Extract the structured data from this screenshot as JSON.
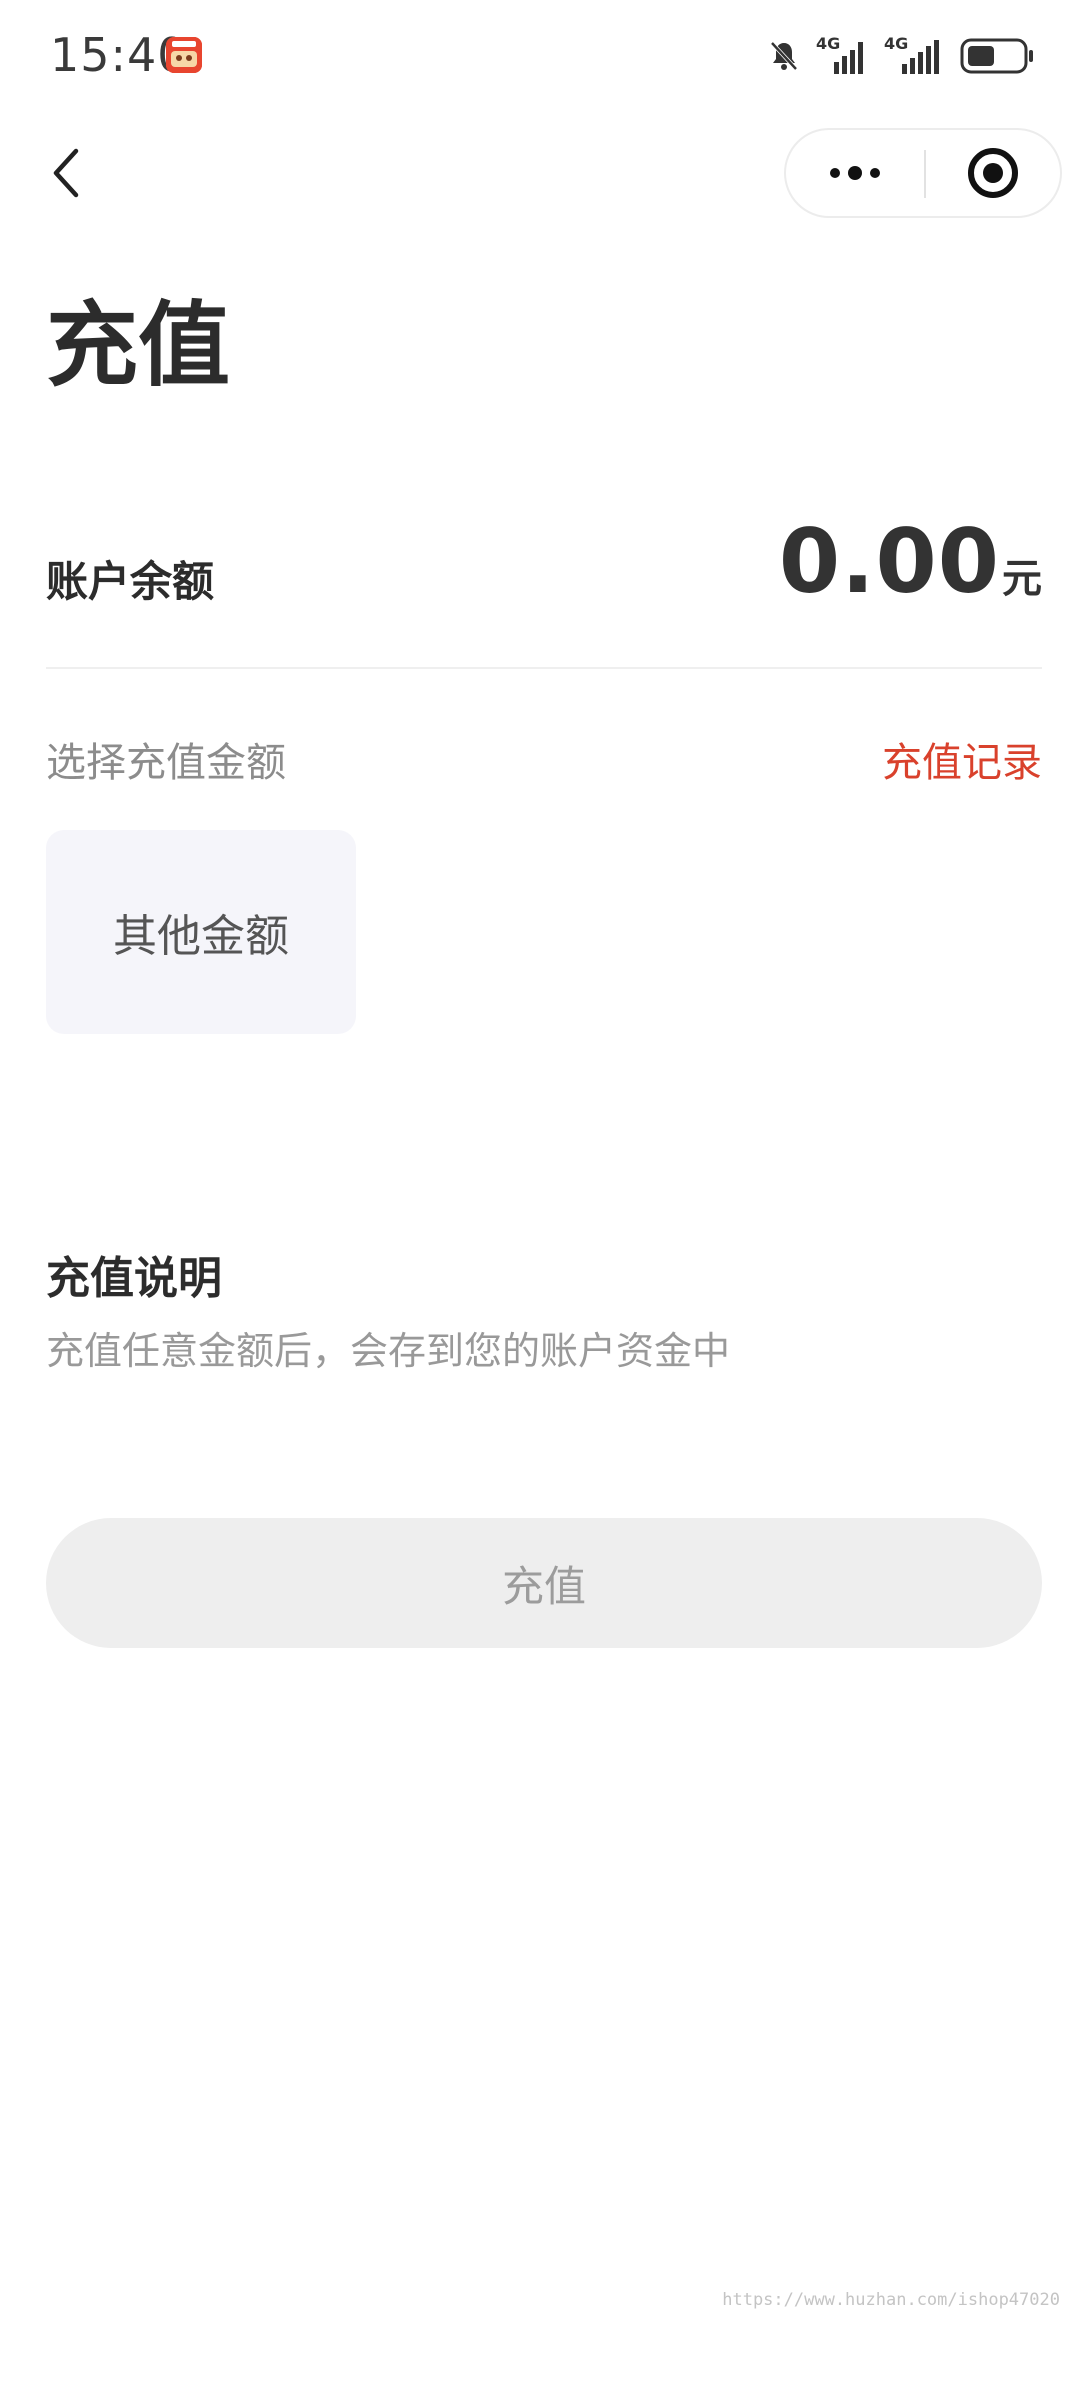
{
  "status_bar": {
    "time": "15:40",
    "app_icon_label": "返抖蚕",
    "icons": [
      "bell-muted-icon",
      "signal-4g-icon",
      "signal-4g-icon",
      "battery-icon"
    ],
    "network_label_1": "4G",
    "network_label_2": "4G"
  },
  "nav": {
    "back_icon": "chevron-left-icon",
    "more_icon": "more-dots-icon",
    "close_icon": "target-close-icon"
  },
  "page": {
    "title": "充值"
  },
  "balance": {
    "label": "账户余额",
    "value": "0.00",
    "unit": "元"
  },
  "select": {
    "label": "选择充值金额",
    "record_link": "充值记录",
    "other_amount": "其他金额"
  },
  "description": {
    "title": "充值说明",
    "text": "充值任意金额后，会存到您的账户资金中"
  },
  "actions": {
    "recharge_label": "充值"
  },
  "watermark": "https://www.huzhan.com/ishop47020",
  "colors": {
    "accent": "#d9412c",
    "button_bg": "#eeeeee",
    "card_bg": "#f5f5fa"
  }
}
